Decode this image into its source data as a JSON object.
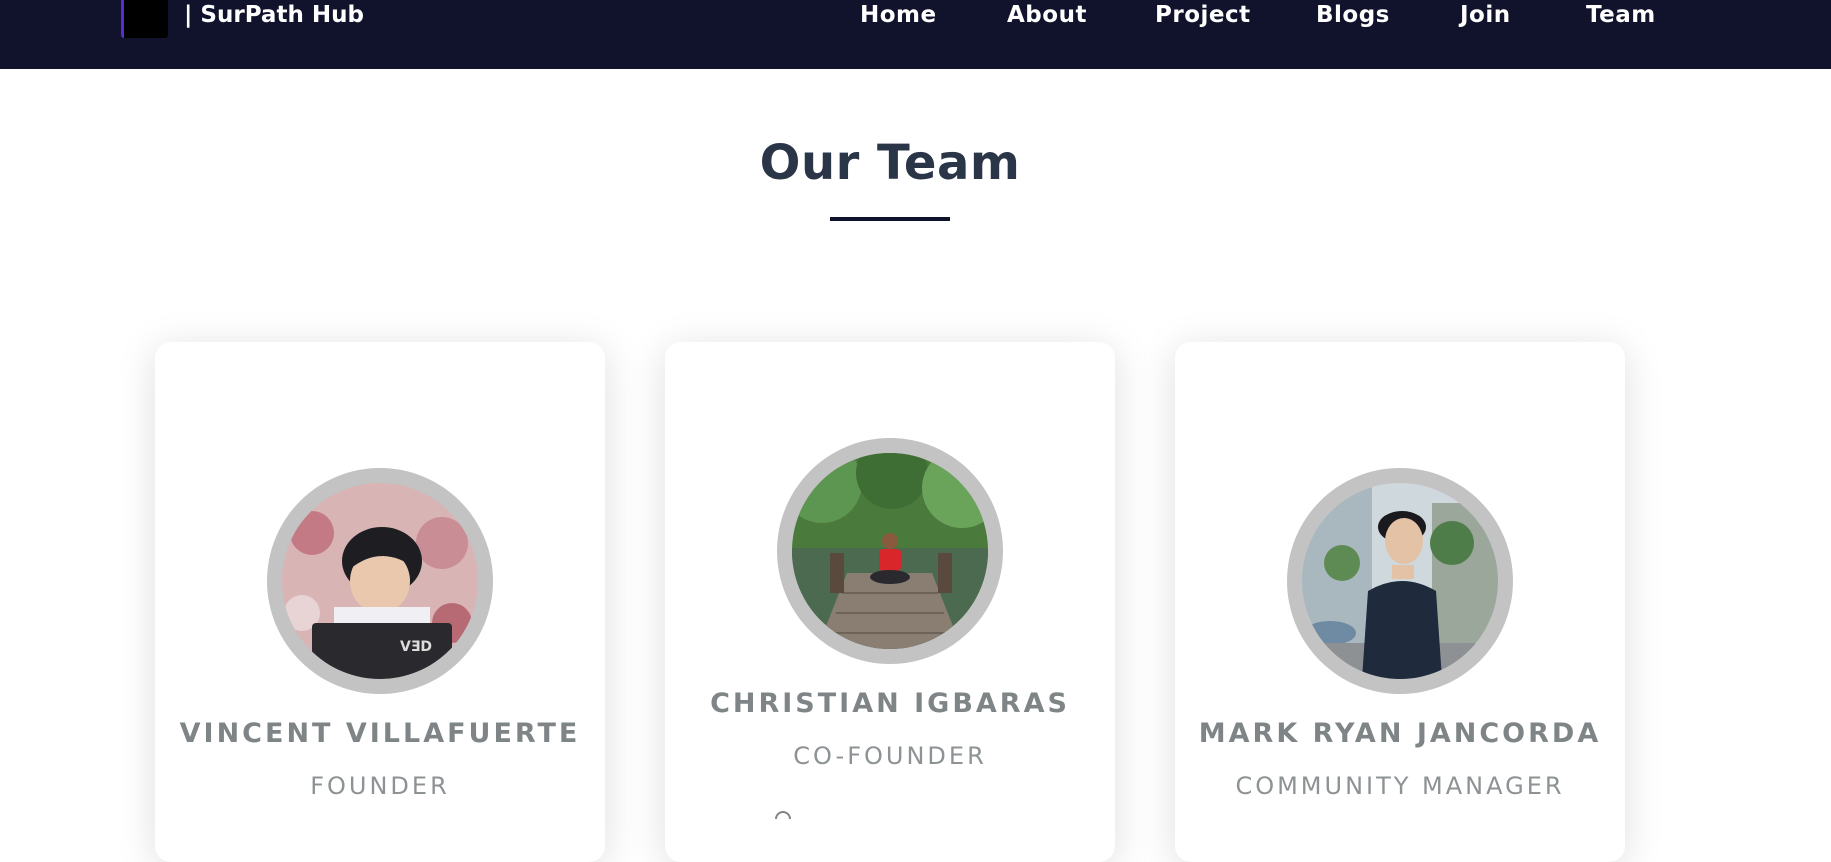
{
  "brand": {
    "title": "| SurPath Hub"
  },
  "nav": {
    "home": "Home",
    "about": "About",
    "project": "Project",
    "blogs": "Blogs",
    "join": "Join",
    "team": "Team"
  },
  "team_section": {
    "heading": "Our Team"
  },
  "members": [
    {
      "name": "VINCENT VILLAFUERTE",
      "role": "FOUNDER"
    },
    {
      "name": "CHRISTIAN IGBARAS",
      "role": "CO-FOUNDER"
    },
    {
      "name": "MARK RYAN JANCORDA",
      "role": "COMMUNITY MANAGER"
    }
  ],
  "colors": {
    "navbar_bg": "#11122b",
    "heading": "#2a3548",
    "name_text": "#7f8587",
    "avatar_ring": "#c3c3c3",
    "logo_accent": "#5b2bd6"
  }
}
